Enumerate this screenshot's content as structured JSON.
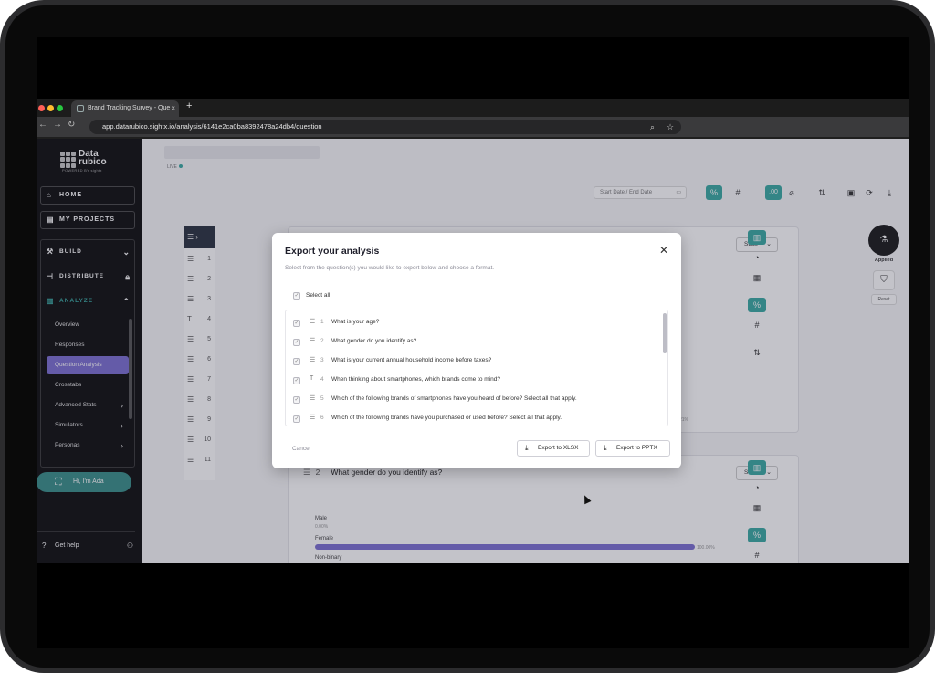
{
  "browser": {
    "tab_title": "Brand Tracking Survey - Que",
    "tab_close": "×",
    "new_tab": "+",
    "url": "app.datarubico.sightx.io/analysis/6141e2ca0ba8392478a24db4/question"
  },
  "sidebar": {
    "logo_text_1": "Data",
    "logo_text_2": "rubico",
    "logo_sub": "POWERED BY sightx",
    "home": "HOME",
    "my_projects": "MY PROJECTS",
    "build": "BUILD",
    "distribute": "DISTRIBUTE",
    "analyze": "ANALYZE",
    "analyze_items": [
      "Overview",
      "Responses",
      "Question Analysis",
      "Crosstabs",
      "Advanced Stats",
      "Simulators",
      "Personas"
    ],
    "ada": "Hi, I'm Ada",
    "help": "Get help"
  },
  "main": {
    "live": "LIVE",
    "dates": "Start Date  /  End Date",
    "q_numbers": [
      "1",
      "2",
      "3",
      "4",
      "5",
      "6",
      "7",
      "8",
      "9",
      "10",
      "11"
    ],
    "stats_label": "Stats",
    "card2_num": "2",
    "card2_title": "What gender do you identify as?",
    "bars": [
      {
        "label": "Male",
        "pct": "0.00%",
        "value": 0
      },
      {
        "label": "Female",
        "pct": "100.00%",
        "value": 100
      },
      {
        "label": "Non-binary",
        "pct": "",
        "value": 0
      }
    ],
    "bg_pct": "21%",
    "applied": "Applied",
    "reset": "Reset"
  },
  "modal": {
    "title": "Export your analysis",
    "close": "✕",
    "description": "Select from the question(s) you would like to export below and choose a format.",
    "select_all": "Select all",
    "questions": [
      {
        "num": "1",
        "icon": "list",
        "text": "What is your age?"
      },
      {
        "num": "2",
        "icon": "list",
        "text": "What gender do you identify as?"
      },
      {
        "num": "3",
        "icon": "list",
        "text": "What is your current annual household income before taxes?"
      },
      {
        "num": "4",
        "icon": "text",
        "text": "When thinking about smartphones, which brands come to mind?"
      },
      {
        "num": "5",
        "icon": "list",
        "text": "Which of the following brands of smartphones have you heard of before? Select all that apply."
      },
      {
        "num": "6",
        "icon": "list",
        "text": "Which of the following brands have you purchased or used before? Select all that apply."
      }
    ],
    "cancel": "Cancel",
    "export_xlsx": "Export to XLSX",
    "export_pptx": "Export to PPTX"
  },
  "colors": {
    "accent_teal": "#3aa9a2",
    "accent_purple": "#7c6fd1",
    "sidebar_bg": "#0f0f0f"
  }
}
